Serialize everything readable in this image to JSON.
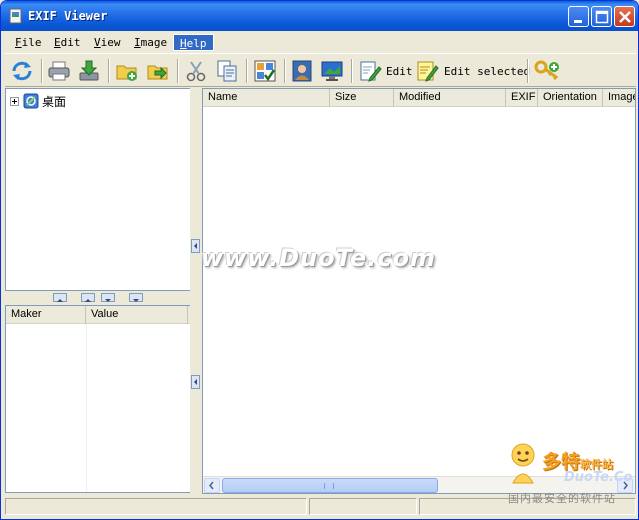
{
  "window": {
    "title": "EXIF Viewer"
  },
  "menu": [
    {
      "key": "F",
      "rest": "ile"
    },
    {
      "key": "E",
      "rest": "dit"
    },
    {
      "key": "V",
      "rest": "iew"
    },
    {
      "key": "I",
      "rest": "mage"
    },
    {
      "key": "H",
      "rest": "elp"
    }
  ],
  "toolbar": {
    "edit_label": "Edit",
    "edit_selected_label": "Edit selected"
  },
  "tree": {
    "root_label": "桌面"
  },
  "file_columns": [
    "Name",
    "Size",
    "Modified",
    "EXIF",
    "Orientation",
    "Image"
  ],
  "exif_columns": [
    "Maker",
    "Value"
  ],
  "watermark": {
    "text": "www.DuoTe.com",
    "logo_main": "多特",
    "logo_small": "软件站",
    "logo_site": "DuoTe.Co",
    "logo_sub": "国内最安全的软件站"
  }
}
